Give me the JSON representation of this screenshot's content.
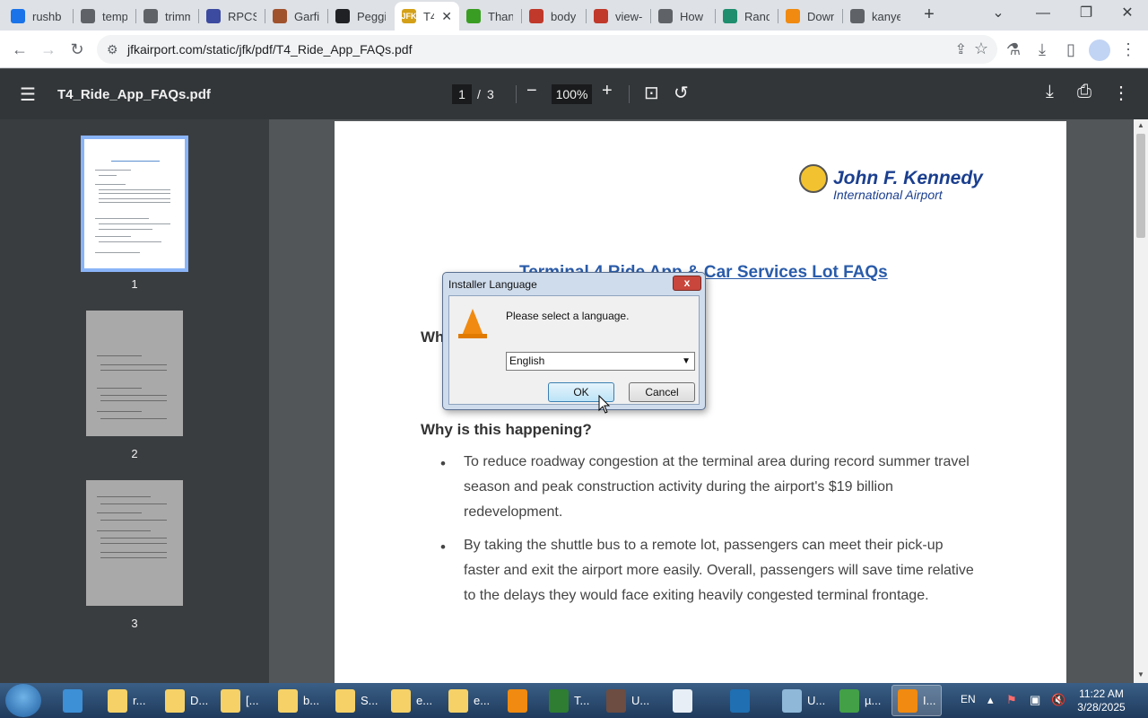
{
  "browser": {
    "tabs": [
      {
        "label": "rushb",
        "color": "#1a73e8"
      },
      {
        "label": "temp",
        "color": "#5f6368"
      },
      {
        "label": "trimm",
        "color": "#5f6368"
      },
      {
        "label": "RPCS",
        "color": "#3c4aa0"
      },
      {
        "label": "Garfie",
        "color": "#a0522d"
      },
      {
        "label": "Peggi",
        "color": "#202124"
      },
      {
        "label": "T4",
        "color": "#d4a017"
      },
      {
        "label": "Thank",
        "color": "#3a9d23"
      },
      {
        "label": "body",
        "color": "#c0392b"
      },
      {
        "label": "view-",
        "color": "#c0392b"
      },
      {
        "label": "How",
        "color": "#5f6368"
      },
      {
        "label": "Rand",
        "color": "#1e8e6e"
      },
      {
        "label": "Down",
        "color": "#f08a10"
      },
      {
        "label": "kanye",
        "color": "#5f6368"
      }
    ],
    "active_tab_favicon": "JFK",
    "url": "jfkairport.com/static/jfk/pdf/T4_Ride_App_FAQs.pdf"
  },
  "pdf": {
    "filename": "T4_Ride_App_FAQs.pdf",
    "current_page": "1",
    "page_separator": "/",
    "total_pages": "3",
    "zoom": "100%",
    "thumbnails": [
      "1",
      "2",
      "3"
    ]
  },
  "document": {
    "logo_name": "John F. Kennedy",
    "logo_sub": "International Airport",
    "title": "Terminal 4 Ride App & Car Services Lot FAQs",
    "heading_partial": "Wh",
    "heading2": "Why is this happening?",
    "bullet_char": "•",
    "bullets": [
      "To reduce roadway congestion at the terminal area during record summer travel season and peak construction activity during the airport's $19 billion redevelopment.",
      "By taking the shuttle bus to a remote lot, passengers can meet their pick-up faster and exit the airport more easily. Overall, passengers will save time relative to the delays they would face exiting heavily congested terminal frontage."
    ]
  },
  "dialog": {
    "title": "Installer Language",
    "prompt": "Please select a language.",
    "selected_language": "English",
    "ok_label": "OK",
    "cancel_label": "Cancel",
    "close_glyph": "x"
  },
  "taskbar": {
    "items": [
      {
        "label": "",
        "color": "#3d8fd6"
      },
      {
        "label": "r...",
        "color": "#f5d168"
      },
      {
        "label": "D...",
        "color": "#f5d168"
      },
      {
        "label": "[...",
        "color": "#f5d168"
      },
      {
        "label": "b...",
        "color": "#f5d168"
      },
      {
        "label": "S...",
        "color": "#f5d168"
      },
      {
        "label": "e...",
        "color": "#f5d168"
      },
      {
        "label": "e...",
        "color": "#f5d168"
      },
      {
        "label": "",
        "color": "#f08a10"
      },
      {
        "label": "T...",
        "color": "#2e7d32"
      },
      {
        "label": "U...",
        "color": "#6d4c41"
      },
      {
        "label": "",
        "color": "#e8eef5"
      },
      {
        "label": "",
        "color": "#1f6fb2"
      },
      {
        "label": "U...",
        "color": "#8fb8d8"
      },
      {
        "label": "µ...",
        "color": "#43a047"
      },
      {
        "label": "I...",
        "color": "#f08a10"
      }
    ],
    "language": "EN",
    "time": "11:22 AM",
    "date": "3/28/2025"
  }
}
